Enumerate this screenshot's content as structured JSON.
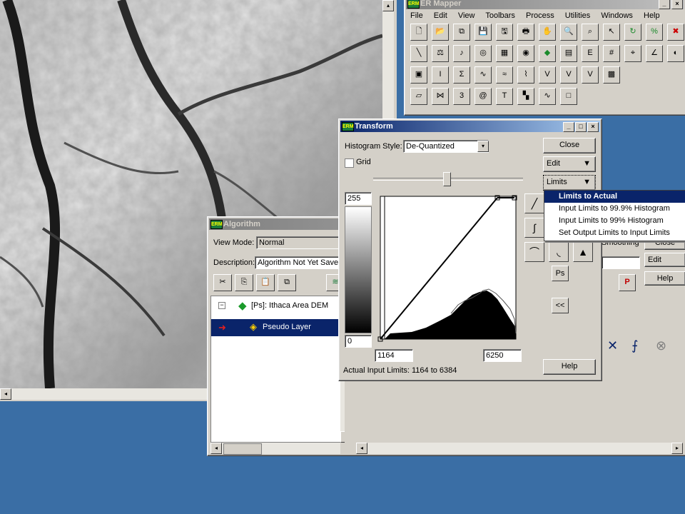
{
  "image_window": {
    "scrollbar": {
      "left_arrow": "◂",
      "up_arrow": "▴"
    }
  },
  "ermapper": {
    "title": "ER Mapper",
    "menu": [
      "File",
      "Edit",
      "View",
      "Toolbars",
      "Process",
      "Utilities",
      "Windows",
      "Help"
    ],
    "toolbar_rows": [
      [
        "new-icon",
        "open-icon",
        "copy-window-icon",
        "save-icon",
        "save-as-icon",
        "print-icon",
        "pan-hand-icon",
        "zoom-icon",
        "zoom-box-icon",
        "pointer-icon",
        "refresh-icon",
        "percent-icon",
        "stop-icon"
      ],
      [
        "line-tool-icon",
        "balance-icon",
        "music-icon",
        "layer-icon",
        "hist-icon",
        "target-icon",
        "stack-icon",
        "folder-icon",
        "formula-icon",
        "grid-icon",
        "crosshair-icon",
        "angle-icon",
        "globe-icon"
      ],
      [
        "image-color-icon",
        "info-icon",
        "stats-icon",
        "wave-icon",
        "wave2-icon",
        "graph-icon",
        "vd-icon",
        "vd2-icon",
        "vd3-icon",
        "thermal-icon"
      ],
      [
        "parallelogram-icon",
        "bowtie-icon",
        "3d-icon",
        "spiral-icon",
        "tm-icon",
        "colorgrid-icon",
        "wave3-icon",
        "square-icon"
      ]
    ]
  },
  "algorithm": {
    "title": "Algorithm",
    "view_mode_label": "View Mode:",
    "view_mode_value": "Normal",
    "description_label": "Description:",
    "description_value": "Algorithm Not Yet Saved",
    "tree_root": "[Ps]: Ithaca Area DEM",
    "tree_layer": "Pseudo Layer",
    "smoothing_label": "Smoothing",
    "close_label": "Close",
    "edit_label": "Edit",
    "help_label": "Help"
  },
  "transform": {
    "title": "Transform",
    "histogram_style_label": "Histogram Style:",
    "histogram_style_value": "De-Quantized",
    "grid_label": "Grid",
    "close_label": "Close",
    "edit_label": "Edit",
    "limits_label": "Limits",
    "output_max": "255",
    "output_min": "0",
    "input_min": "1164",
    "input_max": "6250",
    "actual_limits_text": "Actual Input Limits: 1164 to 6384",
    "help_label": "Help",
    "ps_label": "Ps",
    "collapse_label": "<<"
  },
  "limits_menu": [
    "Limits to Actual",
    "Input Limits to 99.9% Histogram",
    "Input Limits to 99% Histogram",
    "Set Output Limits to Input Limits"
  ],
  "colors": {
    "desktop": "#3a6ea5",
    "title_active": "#0a246a",
    "menu_highlight": "#0a246a"
  }
}
